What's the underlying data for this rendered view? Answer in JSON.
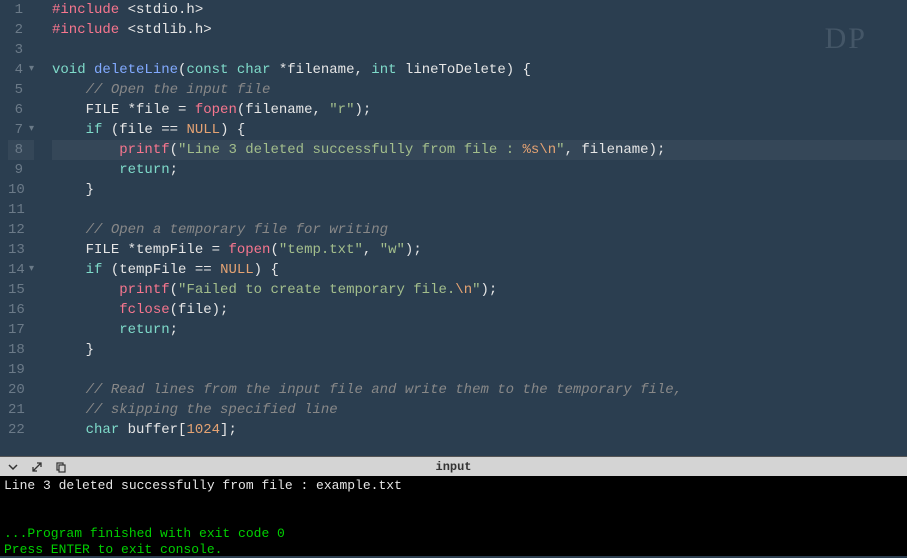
{
  "watermark": "DP",
  "lines": [
    {
      "num": 1
    },
    {
      "num": 2
    },
    {
      "num": 3
    },
    {
      "num": 4,
      "fold": true
    },
    {
      "num": 5
    },
    {
      "num": 6
    },
    {
      "num": 7,
      "fold": true
    },
    {
      "num": 8,
      "active": true
    },
    {
      "num": 9
    },
    {
      "num": 10
    },
    {
      "num": 11
    },
    {
      "num": 12
    },
    {
      "num": 13
    },
    {
      "num": 14,
      "fold": true
    },
    {
      "num": 15
    },
    {
      "num": 16
    },
    {
      "num": 17
    },
    {
      "num": 18
    },
    {
      "num": 19
    },
    {
      "num": 20
    },
    {
      "num": 21
    },
    {
      "num": 22
    }
  ],
  "code": {
    "l1": {
      "include": "#include",
      "header": "<stdio.h>"
    },
    "l2": {
      "include": "#include",
      "header": "<stdlib.h>"
    },
    "l4": {
      "kw_void": "void",
      "fn": "deleteLine",
      "kw_const": "const",
      "kw_char": "char",
      "p1": "*filename,",
      "kw_int": "int",
      "p2": "lineToDelete) {"
    },
    "l5": {
      "comment": "// Open the input file"
    },
    "l6": {
      "type": "FILE",
      "var": "*file =",
      "fn": "fopen",
      "arg1": "(filename,",
      "str": "\"r\"",
      "end": ");"
    },
    "l7": {
      "kw_if": "if",
      "expr": "(file ==",
      "null": "NULL",
      "end": ") {"
    },
    "l8": {
      "fn": "printf",
      "open": "(",
      "str1": "\"Line 3 deleted successfully from file",
      "str2": " : ",
      "fmt": "%s",
      "esc": "\\n",
      "strend": "\"",
      "args": ", filename);"
    },
    "l9": {
      "kw": "return",
      "end": ";"
    },
    "l10": {
      "brace": "}"
    },
    "l12": {
      "comment": "// Open a temporary file for writing"
    },
    "l13": {
      "type": "FILE",
      "var": "*tempFile =",
      "fn": "fopen",
      "open": "(",
      "str1": "\"temp.txt\"",
      "comma": ", ",
      "str2": "\"w\"",
      "end": ");"
    },
    "l14": {
      "kw_if": "if",
      "expr": "(tempFile ==",
      "null": "NULL",
      "end": ") {"
    },
    "l15": {
      "fn": "printf",
      "open": "(",
      "str": "\"Failed to create temporary file.",
      "esc": "\\n",
      "strend": "\"",
      "end": ");"
    },
    "l16": {
      "fn": "fclose",
      "args": "(file);"
    },
    "l17": {
      "kw": "return",
      "end": ";"
    },
    "l18": {
      "brace": "}"
    },
    "l20": {
      "comment": "// Read lines from the input file and write them to the temporary file,"
    },
    "l21": {
      "comment": "// skipping the specified line"
    },
    "l22": {
      "kw": "char",
      "var": "buffer[",
      "num": "1024",
      "end": "];"
    }
  },
  "toolbar": {
    "label": "input"
  },
  "console": {
    "line1": "Line 3 deleted successfully from file : example.txt",
    "line2": "",
    "line3": "...Program finished with exit code 0",
    "line4": "Press ENTER to exit console."
  }
}
